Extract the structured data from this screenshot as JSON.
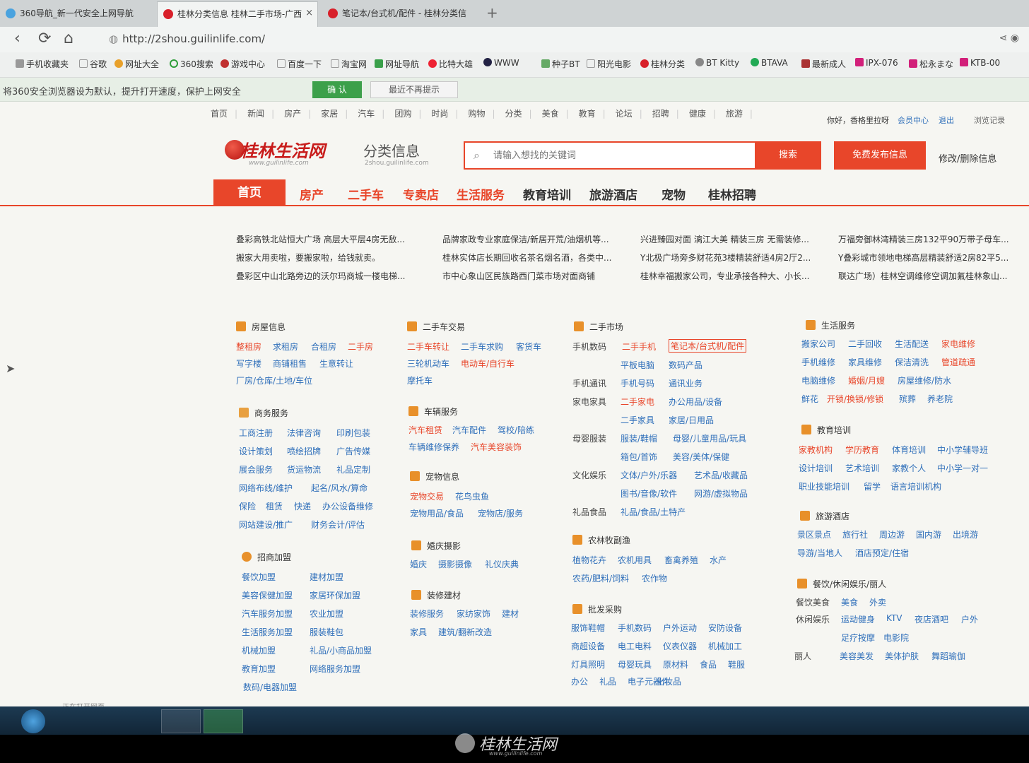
{
  "browser": {
    "tabs": [
      {
        "title": "360导航_新一代安全上网导航"
      },
      {
        "title": "桂林分类信息 桂林二手市场-广西",
        "close": "×"
      },
      {
        "title": "笔记本/台式机/配件 - 桂林分类信"
      }
    ],
    "new_tab": "+",
    "url": "http://2shou.guilinlife.com/",
    "bookmarks": [
      "手机收藏夹",
      "谷歌",
      "网址大全",
      "360搜索",
      "游戏中心",
      "百度一下",
      "淘宝网",
      "网址导航",
      "比特大雄",
      "WWW",
      "种子BT",
      "阳光电影",
      "桂林分类",
      "BT Kitty",
      "BTAVA",
      "最新成人",
      "IPX-076",
      "松永まな",
      "KTB-00"
    ],
    "notify": {
      "text": "将360安全浏览器设为默认，提升打开速度，保护上网安全",
      "confirm": "确 认",
      "dismiss": "最近不再提示"
    }
  },
  "site": {
    "topnav": [
      "首页",
      "新闻",
      "房产",
      "家居",
      "汽车",
      "团购",
      "时尚",
      "购物",
      "分类",
      "美食",
      "教育",
      "论坛",
      "招聘",
      "健康",
      "旅游"
    ],
    "greeting": "你好，香格里拉呀",
    "member": "会员中心",
    "logout": "退出",
    "history": "浏览记录",
    "logo_text": "桂林生活网",
    "logo_sub": "www.guilinlife.com",
    "fenlei": "分类信息",
    "fenlei_sub": "2shou.guilinlife.com",
    "search_placeholder": "请输入想找的关键词",
    "search_btn": "搜索",
    "publish_btn": "免费发布信息",
    "edit_link": "修改/删除信息",
    "mainnav": [
      "首页",
      "房产",
      "二手车",
      "专卖店",
      "生活服务",
      "教育培训",
      "旅游酒店",
      "宠物",
      "桂林招聘"
    ],
    "headlines": [
      "叠彩高铁北站恒大广场 高层大平层4房无敌...",
      "品牌家政专业家庭保洁/新居开荒/油烟机等...",
      "兴进臻园对面 漓江大美 精装三房 无需装修...",
      "万福旁御林湾精装三房132平90万带子母车...",
      "搬家大用卖啦，要搬家啦，给钱就卖。",
      "桂林实体店长期回收名茶名烟名酒，各类中...",
      "Y北极广场旁多财花苑3楼精装舒适4房2厅2...",
      "Y叠彩城市领地电梯高层精装舒适2房82平5...",
      "叠彩区中山北路旁边的沃尔玛商城一楼电梯...",
      "市中心象山区民族路西门菜市场对面商铺",
      "桂林幸福搬家公司，专业承接各种大、小长...",
      "联达广场）桂林空调维修空调加氟桂林象山..."
    ],
    "col1": {
      "house": {
        "title": "房屋信息",
        "links": [
          "整租房",
          "求租房",
          "合租房",
          "二手房",
          "写字楼",
          "商铺租售",
          "生意转让",
          "厂房/仓库/土地/车位"
        ]
      },
      "biz": {
        "title": "商务服务",
        "links": [
          "工商注册",
          "法律咨询",
          "印刷包装",
          "设计策划",
          "喷绘招牌",
          "广告传媒",
          "展会服务",
          "货运物流",
          "礼品定制",
          "网络布线/维护",
          "起名/风水/算命",
          "保险",
          "租赁",
          "快递",
          "办公设备维修",
          "网站建设/推广",
          "财务会计/评估"
        ]
      },
      "join": {
        "title": "招商加盟",
        "links": [
          "餐饮加盟",
          "建材加盟",
          "美容保健加盟",
          "家居环保加盟",
          "汽车服务加盟",
          "农业加盟",
          "生活服务加盟",
          "服装鞋包",
          "机械加盟",
          "礼品/小商品加盟",
          "教育加盟",
          "网络服务加盟",
          "数码/电器加盟"
        ]
      }
    },
    "col2": {
      "car": {
        "title": "二手车交易",
        "links": [
          "二手车转让",
          "二手车求购",
          "客货车",
          "三轮机动车",
          "电动车/自行车",
          "摩托车"
        ]
      },
      "vehicle": {
        "title": "车辆服务",
        "links": [
          "汽车租赁",
          "汽车配件",
          "驾校/陪练",
          "车辆维修保养",
          "汽车美容装饰"
        ]
      },
      "pet": {
        "title": "宠物信息",
        "links": [
          "宠物交易",
          "花鸟虫鱼",
          "宠物用品/食品",
          "宠物店/服务"
        ]
      },
      "wedding": {
        "title": "婚庆摄影",
        "links": [
          "婚庆",
          "摄影摄像",
          "礼仪庆典"
        ]
      },
      "build": {
        "title": "装修建材",
        "links": [
          "装修服务",
          "家纺家饰",
          "建材",
          "家具",
          "建筑/翻新改造"
        ]
      }
    },
    "col3": {
      "market": {
        "title": "二手市场",
        "rows": [
          {
            "label": "手机数码",
            "links": [
              "二手手机",
              "笔记本/台式机/配件",
              "平板电脑",
              "数码产品"
            ]
          },
          {
            "label": "手机通讯",
            "links": [
              "手机号码",
              "通讯业务"
            ]
          },
          {
            "label": "家电家具",
            "links": [
              "二手家电",
              "办公用品/设备",
              "二手家具",
              "家居/日用品"
            ]
          },
          {
            "label": "母婴服装",
            "links": [
              "服装/鞋帽",
              "母婴/儿童用品/玩具",
              "箱包/首饰",
              "美容/美体/保健"
            ]
          },
          {
            "label": "文化娱乐",
            "links": [
              "文体/户外/乐器",
              "艺术品/收藏品",
              "图书/音像/软件",
              "网游/虚拟物品"
            ]
          },
          {
            "label": "礼品食品",
            "links": [
              "礼品/食品/土特产"
            ]
          }
        ]
      },
      "farm": {
        "title": "农林牧副渔",
        "links": [
          "植物花卉",
          "农机用具",
          "畜禽养殖",
          "水产",
          "农药/肥料/饲料",
          "农作物"
        ]
      },
      "wholesale": {
        "title": "批发采购",
        "links": [
          "服饰鞋帽",
          "手机数码",
          "户外运动",
          "安防设备",
          "商超设备",
          "电工电料",
          "仪表仪器",
          "机械加工",
          "灯具照明",
          "母婴玩具",
          "原材料",
          "食品",
          "鞋服",
          "办公",
          "礼品",
          "电子元器件",
          "化妆品"
        ]
      }
    },
    "col4": {
      "life": {
        "title": "生活服务",
        "links": [
          "搬家公司",
          "二手回收",
          "生活配送",
          "家电维修",
          "手机维修",
          "家具维修",
          "保洁清洗",
          "管道疏通",
          "电脑维修",
          "婚姻/月嫂",
          "房屋维修/防水",
          "鲜花",
          "开锁/换锁/修锁",
          "殡葬",
          "养老院"
        ]
      },
      "edu": {
        "title": "教育培训",
        "links": [
          "家教机构",
          "学历教育",
          "体育培训",
          "中小学辅导班",
          "设计培训",
          "艺术培训",
          "家教个人",
          "中小学一对一",
          "职业技能培训",
          "留学",
          "语言培训机构"
        ]
      },
      "travel": {
        "title": "旅游酒店",
        "links": [
          "景区景点",
          "旅行社",
          "周边游",
          "国内游",
          "出境游",
          "导游/当地人",
          "酒店预定/住宿"
        ]
      },
      "fun": {
        "title": "餐饮/休闲娱乐/丽人",
        "row_labels": [
          "餐饮美食",
          "休闲娱乐",
          "丽人"
        ],
        "links": [
          "美食",
          "外卖",
          "运动健身",
          "KTV",
          "夜店酒吧",
          "户外",
          "足疗按摩",
          "电影院",
          "美容美发",
          "美体护肤",
          "舞蹈瑜伽"
        ]
      }
    },
    "status_text": "正在打开网页"
  },
  "watermark": {
    "text": "桂林生活网",
    "sub": "www.guilinlife.com"
  }
}
